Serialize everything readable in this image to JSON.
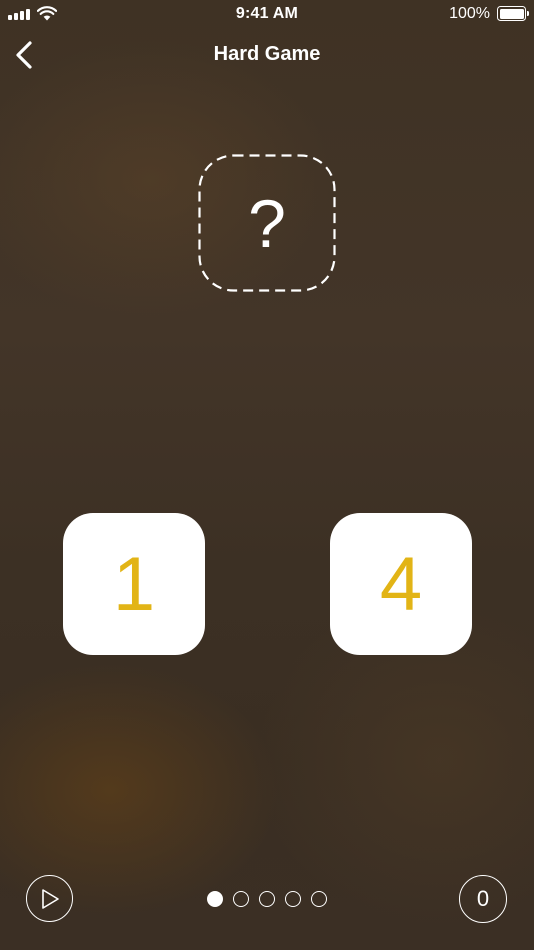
{
  "status_bar": {
    "time": "9:41 AM",
    "battery_percent": "100%",
    "icons": [
      "cellular-signal-icon",
      "wifi-icon",
      "battery-icon"
    ]
  },
  "nav": {
    "back_icon": "chevron-left-icon",
    "title": "Hard Game"
  },
  "target": {
    "text": "?"
  },
  "tiles": [
    {
      "value": "1"
    },
    {
      "value": "4"
    }
  ],
  "controls": {
    "play_icon": "play-icon",
    "score": "0",
    "pages": {
      "total": 5,
      "active_index": 0
    }
  },
  "colors": {
    "tile_text": "#e2b416",
    "tile_background": "#ffffff",
    "foreground": "#ffffff",
    "background": "#3f3224"
  }
}
